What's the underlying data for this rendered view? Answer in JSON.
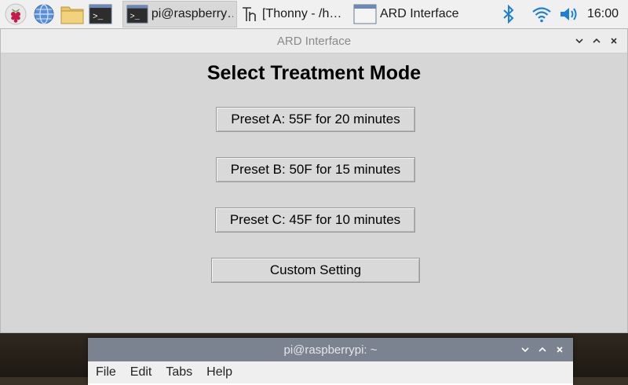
{
  "taskbar": {
    "launchers": [
      {
        "icon": "raspberry-pi-icon"
      },
      {
        "icon": "web-browser-icon"
      },
      {
        "icon": "file-manager-icon"
      },
      {
        "icon": "terminal-icon"
      }
    ],
    "tasks": [
      {
        "label": "pi@raspberry…",
        "icon": "terminal-icon",
        "active": true
      },
      {
        "label": "[Thonny  -  /h…",
        "icon": "thonny-icon",
        "active": false
      },
      {
        "label": "ARD Interface",
        "icon": "window-icon",
        "active": false
      }
    ],
    "tray": {
      "icons": [
        "bluetooth-icon",
        "wifi-icon",
        "volume-icon"
      ],
      "clock": "16:00"
    }
  },
  "ard_window": {
    "title": "ARD Interface",
    "heading": "Select Treatment Mode",
    "buttons": [
      {
        "label": "Preset A: 55F for 20 minutes"
      },
      {
        "label": "Preset B: 50F for 15 minutes"
      },
      {
        "label": "Preset C: 45F for 10 minutes"
      },
      {
        "label": "Custom Setting"
      }
    ]
  },
  "terminal_window": {
    "title": "pi@raspberrypi: ~",
    "menu": [
      "File",
      "Edit",
      "Tabs",
      "Help"
    ]
  },
  "colors": {
    "accent_blue": "#1e7fd6",
    "window_bg": "#d6d6d6"
  }
}
